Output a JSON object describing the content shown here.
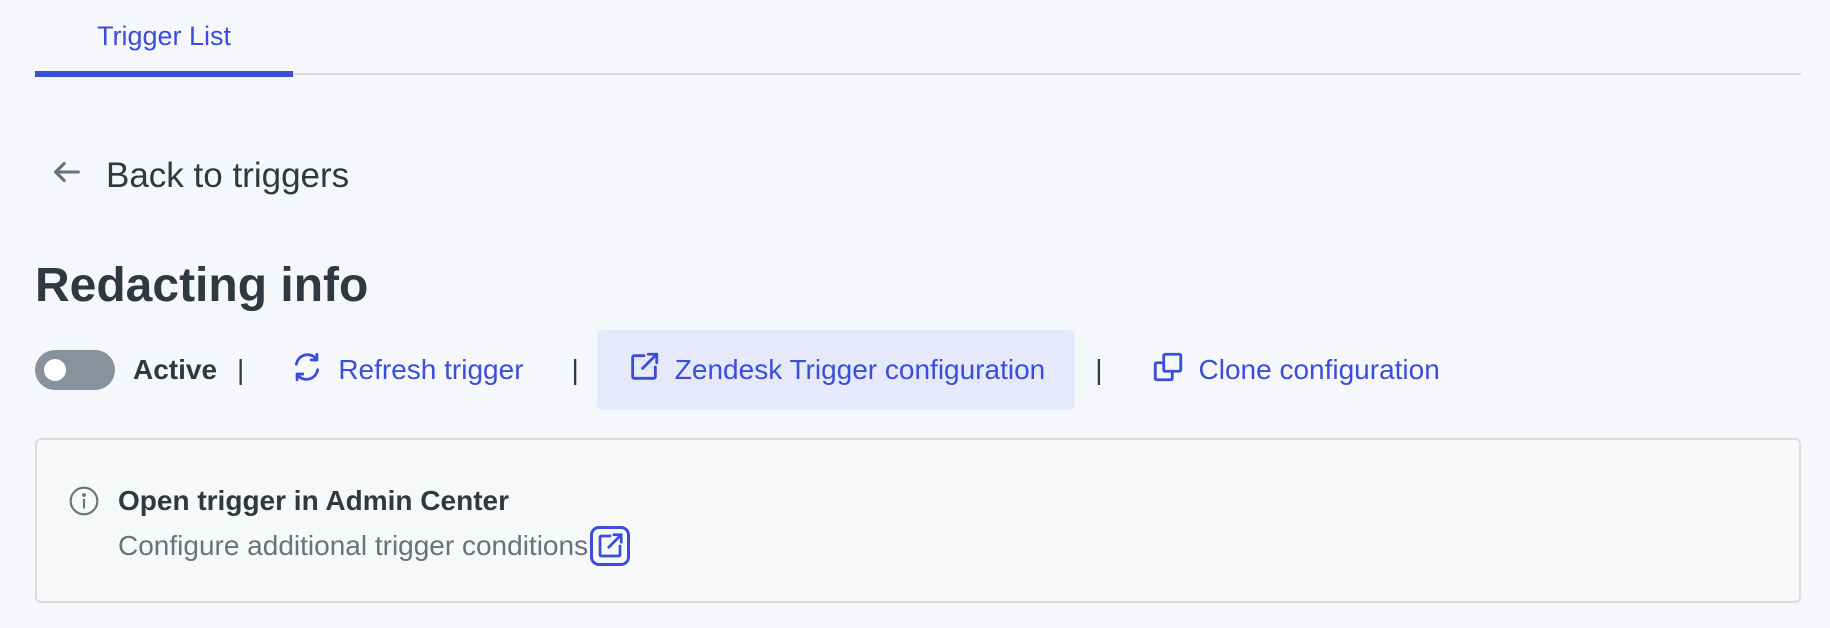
{
  "tabs": [
    {
      "label": "Trigger List",
      "active": true
    }
  ],
  "back": {
    "label": "Back to triggers"
  },
  "page": {
    "title": "Redacting info"
  },
  "actions": {
    "toggle_label": "Active",
    "toggle_on": false,
    "separator": "|",
    "refresh_label": "Refresh trigger",
    "zendesk_config_label": "Zendesk Trigger configuration",
    "clone_label": "Clone configuration"
  },
  "info": {
    "title": "Open trigger in Admin Center",
    "description": "Configure additional trigger conditions"
  },
  "icons": {
    "back": "arrow-left-icon",
    "refresh": "refresh-icon",
    "external": "external-link-icon",
    "clone": "copy-icon",
    "info": "info-icon"
  },
  "colors": {
    "accent": "#3b4edb",
    "text": "#2f3941",
    "muted": "#68737d",
    "toggle_off": "#87929d",
    "highlight_bg": "#e6e9fb",
    "page_bg": "#f6f7fb"
  }
}
